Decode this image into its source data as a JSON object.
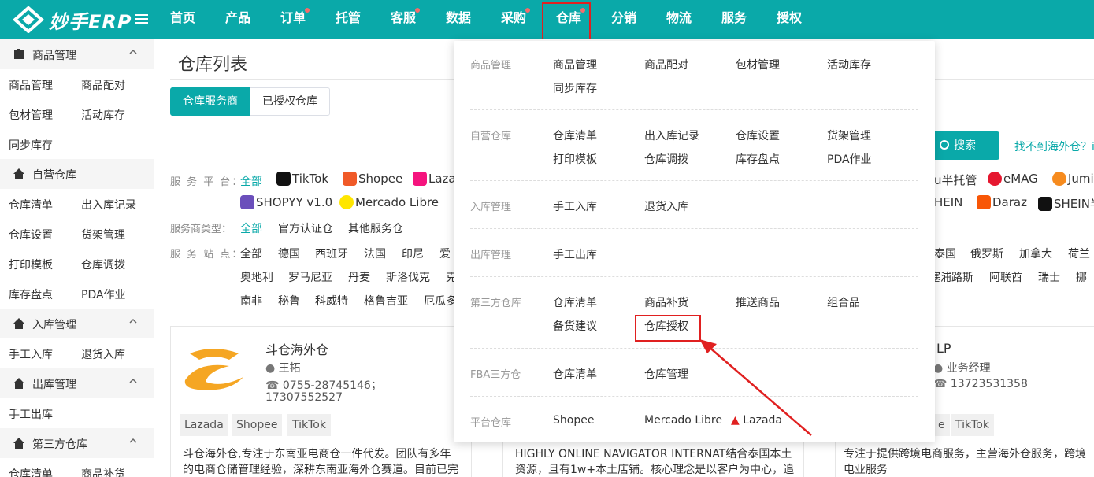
{
  "app": {
    "logo_text": "妙手ERP"
  },
  "nav": {
    "items": [
      {
        "label": "首页",
        "dot": false
      },
      {
        "label": "产品",
        "dot": false
      },
      {
        "label": "订单",
        "dot": true
      },
      {
        "label": "托管",
        "dot": false
      },
      {
        "label": "客服",
        "dot": true
      },
      {
        "label": "数据",
        "dot": false
      },
      {
        "label": "采购",
        "dot": true
      },
      {
        "label": "仓库",
        "dot": true,
        "active": true
      },
      {
        "label": "分销",
        "dot": false
      },
      {
        "label": "物流",
        "dot": false
      },
      {
        "label": "服务",
        "dot": false
      },
      {
        "label": "授权",
        "dot": false
      }
    ]
  },
  "sidebar": {
    "groups": [
      {
        "title": "商品管理",
        "items": [
          "商品管理",
          "商品配对",
          "包材管理",
          "活动库存",
          "同步库存"
        ]
      },
      {
        "title": "自营仓库",
        "items": [
          "仓库清单",
          "出入库记录",
          "仓库设置",
          "货架管理",
          "打印模板",
          "仓库调拨",
          "库存盘点",
          "PDA作业"
        ]
      },
      {
        "title": "入库管理",
        "items": [
          "手工入库",
          "退货入库"
        ]
      },
      {
        "title": "出库管理",
        "items": [
          "手工出库"
        ]
      },
      {
        "title": "第三方仓库",
        "items": [
          "仓库清单",
          "商品补货"
        ]
      }
    ]
  },
  "main": {
    "title": "仓库列表",
    "tabs": [
      "仓库服务商",
      "已授权仓库"
    ],
    "search_label": "搜索",
    "not_found_link": "找不到海外仓？i",
    "filters": {
      "platform_label": "服 务 平 台：",
      "platform_all": "全部",
      "platforms_row1": [
        "TikTok",
        "Shopee",
        "Lazada"
      ],
      "platforms_row1_right": [
        "u半托管",
        "eMAG",
        "Jumia"
      ],
      "platforms_row2": [
        "SHOPYY v1.0",
        "Mercado Libre"
      ],
      "platforms_row2_right": [
        "HEIN",
        "Daraz",
        "SHEIN半"
      ],
      "type_label": "服务商类型：",
      "types": [
        "全部",
        "官方认证仓",
        "其他服务仓"
      ],
      "site_label": "服 务 站 点：",
      "sites_row1": [
        "全部",
        "德国",
        "西班牙",
        "法国",
        "印尼",
        "爱"
      ],
      "sites_row1_right": [
        "泰国",
        "俄罗斯",
        "加拿大",
        "荷兰"
      ],
      "sites_row2": [
        "奥地利",
        "罗马尼亚",
        "丹麦",
        "斯洛伐克",
        "克"
      ],
      "sites_row2_right": [
        "塞浦路斯",
        "阿联酋",
        "瑞士",
        "挪"
      ],
      "sites_row3": [
        "南非",
        "秘鲁",
        "科威特",
        "格鲁吉亚",
        "厄瓜多"
      ]
    },
    "cards": [
      {
        "name": "斗仓海外仓",
        "contact": "王拓",
        "phone": "0755-28745146；",
        "phone2": "17307552527",
        "tags": [
          "Lazada",
          "Shopee",
          "TikTok"
        ],
        "desc": "斗仓海外仓,专注于东南亚电商仓一件代发。团队有多年的电商仓储管理经验，深耕东南亚海外仓赛道。目前已完"
      },
      {
        "desc": "HIGHLY ONLINE NAVIGATOR INTERNAT结合泰国本土资源，且有1w+本土店铺。核心理念是以客户为中心，追"
      },
      {
        "name": "LP",
        "contact": "业务经理",
        "phone": "13723531358",
        "tags": [
          "e",
          "TikTok"
        ],
        "desc": "专注于提供跨境电商服务，主营海外仓服务，跨境电业服务"
      }
    ]
  },
  "dropdown": {
    "sections": [
      {
        "category": "商品管理",
        "items": [
          "商品管理",
          "商品配对",
          "包材管理",
          "活动库存",
          "同步库存"
        ]
      },
      {
        "category": "自营仓库",
        "items": [
          "仓库清单",
          "出入库记录",
          "仓库设置",
          "货架管理",
          "打印模板",
          "仓库调拨",
          "库存盘点",
          "PDA作业"
        ]
      },
      {
        "category": "入库管理",
        "items": [
          "手工入库",
          "退货入库"
        ]
      },
      {
        "category": "出库管理",
        "items": [
          "手工出库"
        ]
      },
      {
        "category": "第三方仓库",
        "items": [
          "仓库清单",
          "商品补货",
          "推送商品",
          "组合品",
          "备货建议",
          "仓库授权"
        ]
      },
      {
        "category": "FBA三方仓",
        "items": [
          "仓库清单",
          "仓库管理"
        ]
      },
      {
        "category": "平台仓库",
        "items": [
          "Shopee",
          "Mercado Libre",
          "Lazada"
        ]
      }
    ]
  },
  "colors": {
    "brand": "#0aa9a9",
    "highlight": "#e02020",
    "dot": "#f56c6c"
  }
}
